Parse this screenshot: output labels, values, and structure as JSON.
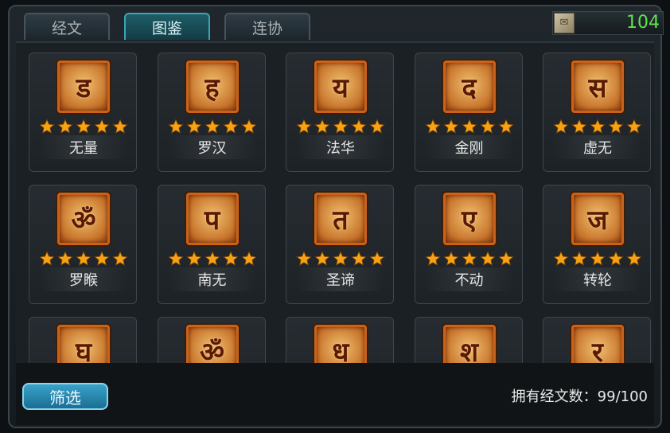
{
  "tabs": [
    {
      "label": "经文",
      "active": false
    },
    {
      "label": "图鉴",
      "active": true
    },
    {
      "label": "连协",
      "active": false
    }
  ],
  "currency": {
    "value": "104",
    "icon": "scroll-icon"
  },
  "cards": [
    {
      "name": "无量",
      "glyph": "ड",
      "stars": 5
    },
    {
      "name": "罗汉",
      "glyph": "ह",
      "stars": 5
    },
    {
      "name": "法华",
      "glyph": "य",
      "stars": 5
    },
    {
      "name": "金刚",
      "glyph": "द",
      "stars": 5
    },
    {
      "name": "虚无",
      "glyph": "स",
      "stars": 5
    },
    {
      "name": "罗睺",
      "glyph": "ॐ",
      "stars": 5
    },
    {
      "name": "南无",
      "glyph": "प",
      "stars": 5
    },
    {
      "name": "圣谛",
      "glyph": "त",
      "stars": 5
    },
    {
      "name": "不动",
      "glyph": "ए",
      "stars": 5
    },
    {
      "name": "转轮",
      "glyph": "ज",
      "stars": 5
    },
    {
      "name": "",
      "glyph": "घ",
      "stars": 0
    },
    {
      "name": "",
      "glyph": "ॐ",
      "stars": 0
    },
    {
      "name": "",
      "glyph": "ध",
      "stars": 0
    },
    {
      "name": "",
      "glyph": "श",
      "stars": 0
    },
    {
      "name": "",
      "glyph": "र",
      "stars": 0
    }
  ],
  "filter_label": "筛选",
  "count_text": "拥有经文数：99/100",
  "colors": {
    "accent": "#39a7b3",
    "currency": "#5fe34b",
    "star": "#f6a313",
    "icon_border": "#c9621b"
  }
}
